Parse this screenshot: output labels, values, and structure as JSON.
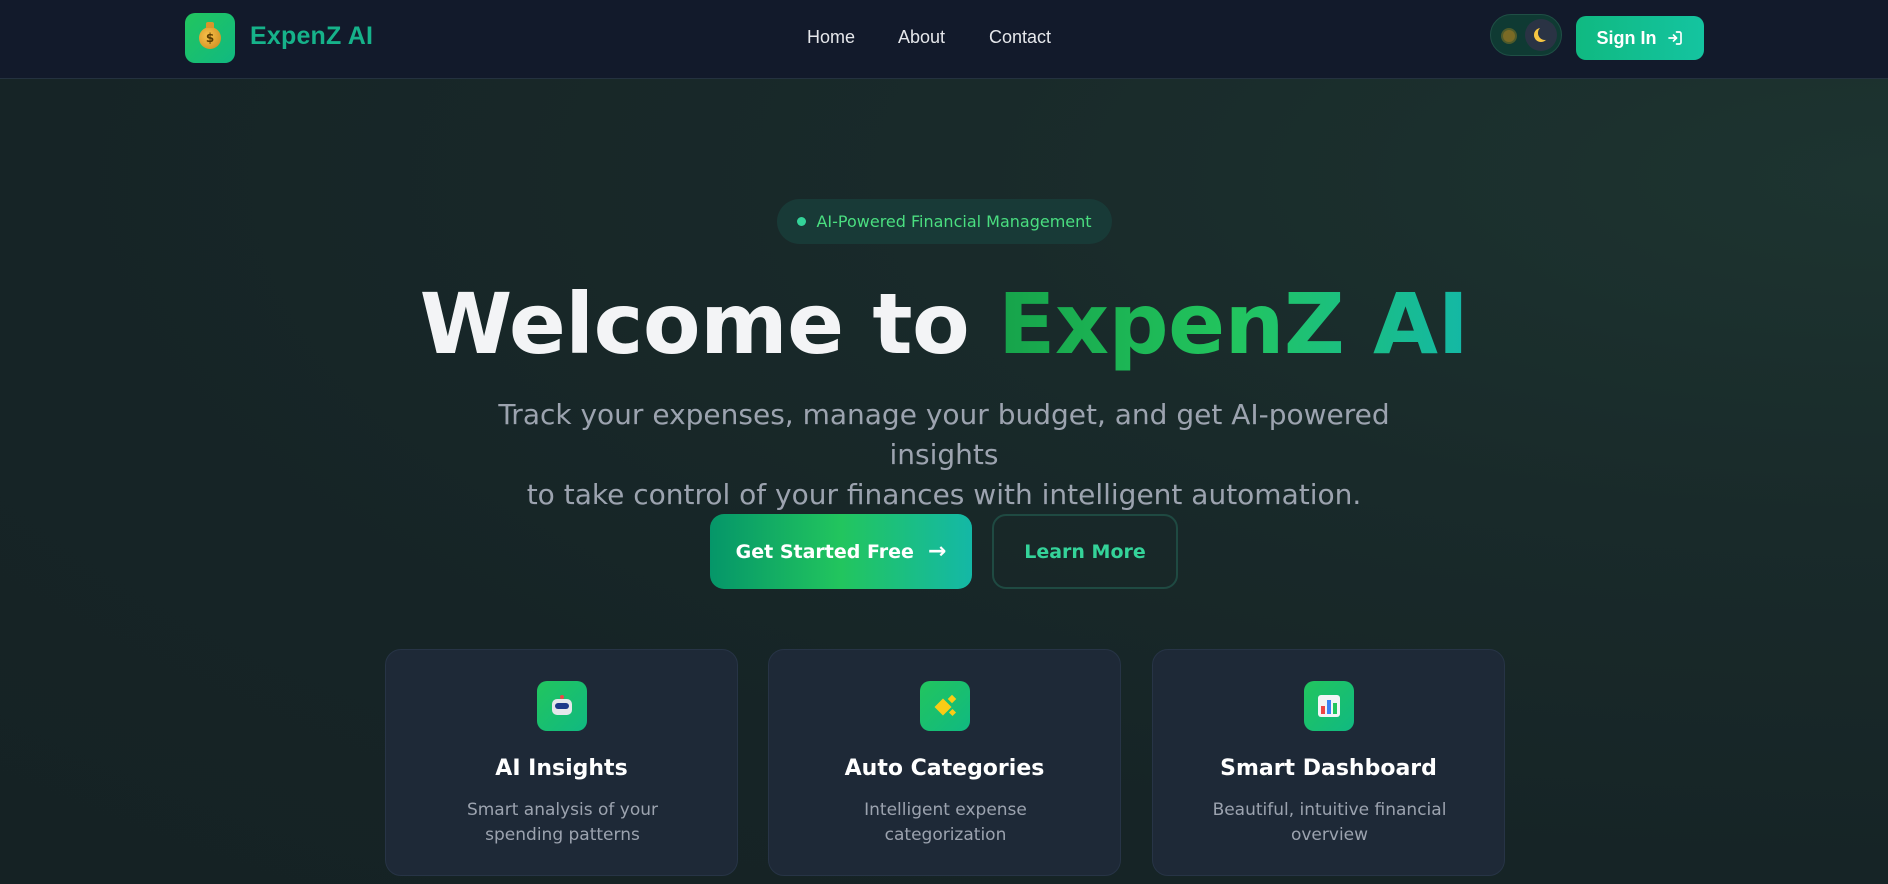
{
  "nav": {
    "brand": "ExpenZ AI",
    "links": [
      "Home",
      "About",
      "Contact"
    ],
    "sign_in": "Sign In",
    "logo_icon": "money-bag-icon"
  },
  "hero": {
    "badge": "AI-Powered Financial Management",
    "title_part1": "Welcome to ",
    "title_part2": "ExpenZ AI",
    "subtitle_line1": "Track your expenses, manage your budget, and get AI-powered insights",
    "subtitle_line2": "to take control of your finances with intelligent automation.",
    "primary_cta": "Get Started Free",
    "primary_cta_arrow": "→",
    "secondary_cta": "Learn More"
  },
  "features": [
    {
      "title": "AI Insights",
      "description": "Smart analysis of your spending patterns",
      "icon": "robot-icon"
    },
    {
      "title": "Auto Categories",
      "description": "Intelligent expense categorization",
      "icon": "sparkles-icon"
    },
    {
      "title": "Smart Dashboard",
      "description": "Beautiful, intuitive financial overview",
      "icon": "bar-chart-icon"
    }
  ],
  "colors": {
    "accent": "#10b981",
    "accent_light": "#22c55e",
    "nav_bg": "#121a2b",
    "card_bg": "#1e2937",
    "text_muted": "#9ca3af"
  }
}
